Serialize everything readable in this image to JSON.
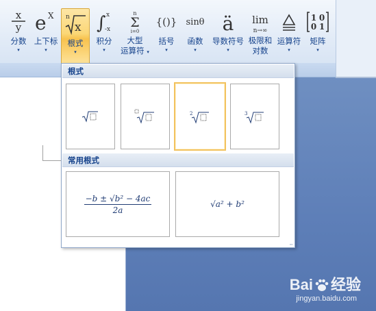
{
  "ribbon": {
    "buttons": [
      {
        "icon": "fraction-icon",
        "glyph": "x/y",
        "label": "分数",
        "caret": "▾"
      },
      {
        "icon": "script-icon",
        "glyph": "eˣ",
        "label": "上下标",
        "caret": "▾"
      },
      {
        "icon": "radical-icon",
        "glyph": "ⁿ√x",
        "label": "根式",
        "caret": "▾"
      },
      {
        "icon": "integral-icon",
        "glyph": "∫",
        "label": "积分",
        "caret": "▾"
      },
      {
        "icon": "large-operator-icon",
        "glyph": "Σ",
        "label": "大型\n运算符",
        "caret": "▾"
      },
      {
        "icon": "bracket-icon",
        "glyph": "{()}",
        "label": "括号",
        "caret": "▾"
      },
      {
        "icon": "function-icon",
        "glyph": "sinθ",
        "label": "函数",
        "caret": "▾"
      },
      {
        "icon": "accent-icon",
        "glyph": "ä",
        "label": "导数符号",
        "caret": "▾"
      },
      {
        "icon": "limit-log-icon",
        "glyph": "lim",
        "label": "极限和\n对数",
        "caret": "▾"
      },
      {
        "icon": "operator-icon",
        "glyph": "≜",
        "label": "运算符",
        "caret": "▾"
      },
      {
        "icon": "matrix-icon",
        "glyph": "[10;01]",
        "label": "矩阵",
        "caret": "▾"
      }
    ]
  },
  "gallery": {
    "section1_title": "根式",
    "section2_title": "常用根式",
    "common": {
      "quadratic_num": "−b ± √b² − 4ac",
      "quadratic_den": "2a",
      "pythag": "√a² + b²"
    }
  },
  "watermark": {
    "brand_left": "Bai",
    "brand_right": "经验",
    "url": "jingyan.baidu.com"
  }
}
